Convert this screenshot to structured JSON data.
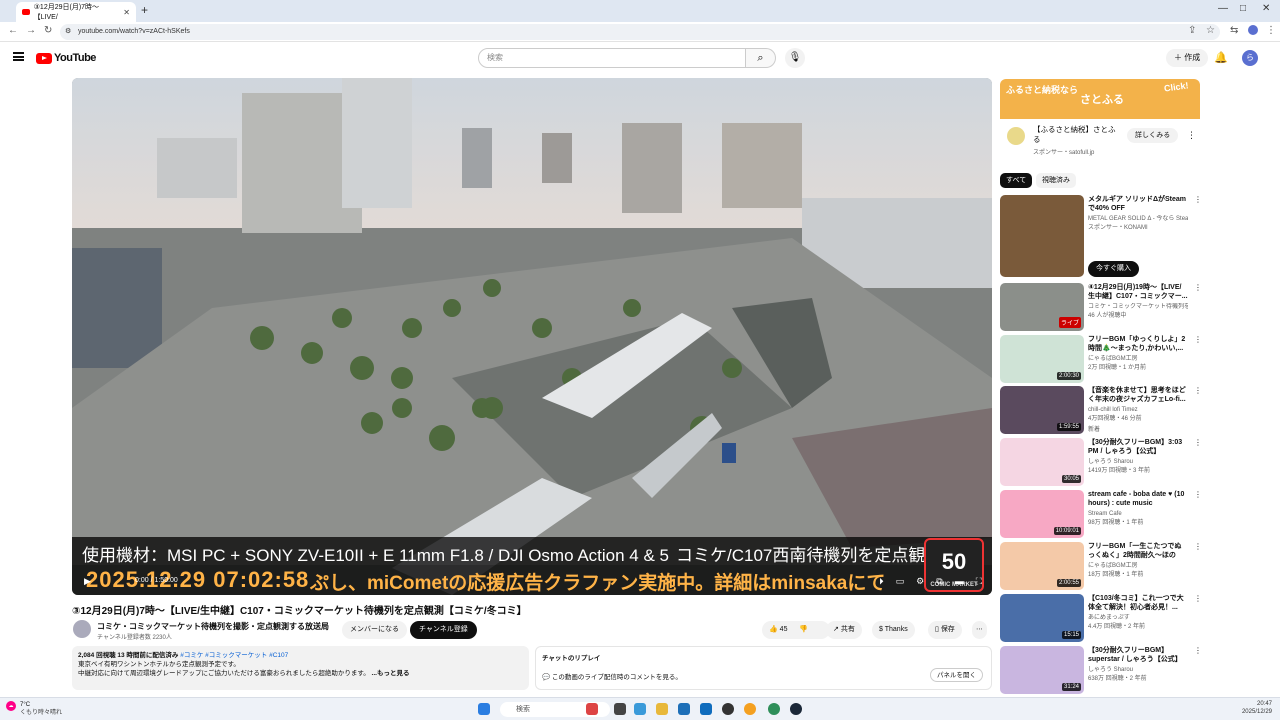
{
  "browser": {
    "tab_title": "③12月29日(月)7時〜【LIVE/",
    "url": "youtube.com/watch?v=zACt-hSKefs"
  },
  "header": {
    "logo": "YouTube",
    "search_placeholder": "検索",
    "create_label": "作成",
    "avatar_letter": "ら"
  },
  "video": {
    "overlay_left": "使用機材：MSI PC + SONY ZV-E10II + E 11mm F1.8 / DJI Osmo Action 4 & 5",
    "overlay_right": "コミケ/C107西南待機列を定点観測",
    "overlay_clock": "2025.12.29 07:02:58",
    "overlay_message": "ぷし、miCometの応援広告クラファン実施中。詳細はminsakaにて",
    "badge": "50",
    "badge_sub": "COMIC MARKET",
    "time_display": "0:00 / 1:50:00"
  },
  "video_info": {
    "title": "③12月29日(月)7時〜【LIVE/生中継】C107・コミックマーケット待機列を定点観測【コミケ/冬コミ】",
    "channel": "コミケ・コミックマーケット待機列を撮影・定点観測する放送局",
    "subscribers": "チャンネル登録者数 2230人",
    "member_button": "メンバーになる",
    "subscribe_button": "チャンネル登録",
    "likes": "45",
    "share": "共有",
    "thanks": "Thanks",
    "save": "保存",
    "desc_meta": "2,084 回視聴 13 時間前に配信済み",
    "desc_tags": "#コミケ #コミックマーケット #C107",
    "desc_line1": "東京ベイ有明ワシントンホテルから定点観測予定です。",
    "desc_line2": "中継対応に向けて周辺環境グレードアップにご協力いただける富豪おられましたら超絶助かります。",
    "desc_more": "...もっと見る",
    "chat_title": "チャットのリプレイ",
    "chat_text": "この動画のライブ配信時のコメントを見る。",
    "chat_button": "パネルを開く"
  },
  "sidebar": {
    "ad_banner_left": "ふるさと納税なら",
    "ad_banner_mid": "さとふる",
    "ad_banner_click": "Click!",
    "ad_title": "【ふるさと納税】さとふる",
    "ad_sponsor": "スポンサー・satofull.jp",
    "ad_button": "詳しくみる",
    "chip_all": "すべて",
    "chip_watched": "視聴済み",
    "buy_now": "今すぐ購入",
    "items": [
      {
        "title": "メタルギア ソリッドΔがSteamで40% OFF",
        "channel": "METAL GEAR SOLID Δ - 今なら Steam40% OFF",
        "views": "スポンサー・KONAMI",
        "extra": "",
        "duration": "",
        "thumb_color": "#7a5a3a"
      },
      {
        "title": "④12月29日(月)19時〜【LIVE/生中継】C107・コミックマー...",
        "channel": "コミケ・コミックマーケット待機列を撮...",
        "views": "46 人が視聴中",
        "extra": "",
        "duration": "ライブ",
        "thumb_color": "#8b8f8a"
      },
      {
        "title": "フリーBGM「ゆっくりしよ」2時間🎄〜まったり,かわいい,...",
        "channel": "にゃるぱBGM工房",
        "views": "2万 回視聴・1 か月前",
        "extra": "",
        "duration": "2:00:30",
        "thumb_color": "#cfe3d6"
      },
      {
        "title": "【音楽を休ませて】思考をほどく年末の夜ジャズカフェLo-fi...",
        "channel": "chill-chill lofi Timez",
        "views": "4万回視聴・46 分前",
        "extra": "新着",
        "duration": "1:59:55",
        "thumb_color": "#5a4a5e"
      },
      {
        "title": "【30分耐久フリーBGM】3:03 PM / しゃろう【公式】",
        "channel": "しゃろう Sharou",
        "views": "1419万 回視聴・3 年前",
        "extra": "",
        "duration": "30:05",
        "thumb_color": "#f5d6e3"
      },
      {
        "title": "stream cafe - boba date ♥ (10 hours) : cute music",
        "channel": "Stream Cafe",
        "views": "98万 回視聴・1 年前",
        "extra": "",
        "duration": "10:09:01",
        "thumb_color": "#f7a8c4"
      },
      {
        "title": "フリーBGM「一生こたつでぬっくぬく」2時間耐久〜ほのぼ...",
        "channel": "にゃるぱBGM工房",
        "views": "18万 回視聴・1 年前",
        "extra": "",
        "duration": "2:00:55",
        "thumb_color": "#f4c9a8"
      },
      {
        "title": "【C103/冬コミ】これ一つで大体全て解決！初心者必見！...",
        "channel": "あにめまっぷす",
        "views": "4.4万 回視聴・2 年前",
        "extra": "",
        "duration": "15:15",
        "thumb_color": "#4a6ea8"
      },
      {
        "title": "【30分耐久フリーBGM】superstar / しゃろう【公式】",
        "channel": "しゃろう Sharou",
        "views": "638万 回視聴・2 年前",
        "extra": "",
        "duration": "31:24",
        "thumb_color": "#c9b6e0"
      }
    ]
  },
  "taskbar": {
    "temp": "7°C",
    "weather": "くもり時々晴れ",
    "search": "検索",
    "time": "20:47",
    "date": "2025/12/29"
  }
}
